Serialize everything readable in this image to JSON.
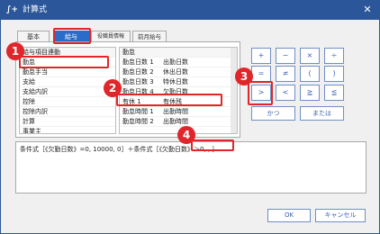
{
  "window": {
    "app_icon": "∫+",
    "title": "計算式",
    "close_label": "✕"
  },
  "tabs": [
    {
      "label": "基本"
    },
    {
      "label": "給与"
    },
    {
      "label": "役職員情報"
    },
    {
      "label": "前月給与"
    }
  ],
  "left_list": {
    "items": [
      "給与項目連動",
      "勤怠",
      "勤怠手当",
      "支給",
      "支給内訳",
      "控除",
      "控除内訳",
      "計算",
      "事業主"
    ]
  },
  "middle_list": {
    "rows": [
      {
        "c1": "勤怠",
        "c2": ""
      },
      {
        "c1": "勤怠日数 1",
        "c2": "出勤日数"
      },
      {
        "c1": "勤怠日数 2",
        "c2": "休出日数"
      },
      {
        "c1": "勤怠日数 3",
        "c2": "特休日数"
      },
      {
        "c1": "勤怠日数 4",
        "c2": "欠勤日数"
      },
      {
        "c1": "有休 1",
        "c2": "有休残"
      },
      {
        "c1": "勤怠時間 1",
        "c2": "出勤時間"
      },
      {
        "c1": "勤怠時間 2",
        "c2": "出勤時間"
      }
    ]
  },
  "operators": [
    "+",
    "−",
    "×",
    "÷",
    "=",
    "≠",
    "(",
    ")",
    ">",
    "<",
    "≧",
    "≦"
  ],
  "word_buttons": {
    "and": "かつ",
    "or": "または"
  },
  "formula": {
    "line1": "条件式［《欠勤日数》=0, 10000, 0］＋条件式［《欠勤日数》＞0, , ］"
  },
  "footer": {
    "ok": "OK",
    "cancel": "キャンセル"
  },
  "callouts": [
    "1",
    "2",
    "3",
    "4"
  ],
  "colors": {
    "accent": "#2b6cc8",
    "title_bar": "#2b579a",
    "callout": "#e0262a"
  }
}
